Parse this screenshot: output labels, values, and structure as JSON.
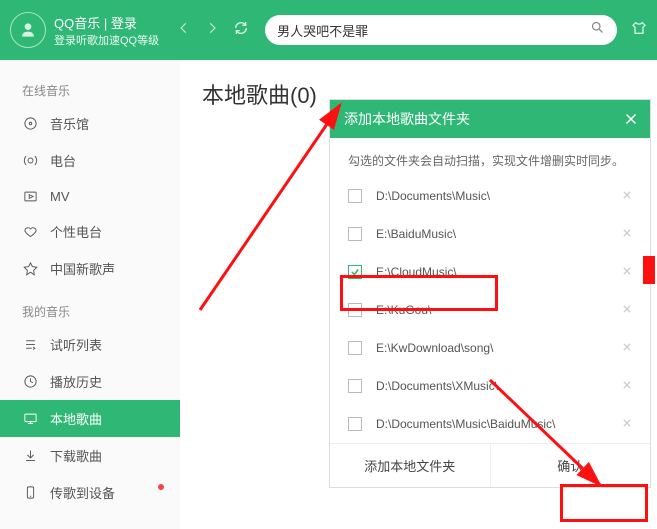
{
  "header": {
    "app_title": "QQ音乐 | 登录",
    "login_sub": "登录听歌加速QQ等级",
    "search_value": "男人哭吧不是罪"
  },
  "sidebar": {
    "section_online": "在线音乐",
    "online_items": [
      {
        "label": "音乐馆",
        "icon": "disc"
      },
      {
        "label": "电台",
        "icon": "radio"
      },
      {
        "label": "MV",
        "icon": "play"
      },
      {
        "label": "个性电台",
        "icon": "heart"
      },
      {
        "label": "中国新歌声",
        "icon": "star"
      }
    ],
    "section_mine": "我的音乐",
    "mine_items": [
      {
        "label": "试听列表",
        "icon": "list"
      },
      {
        "label": "播放历史",
        "icon": "clock"
      },
      {
        "label": "本地歌曲",
        "icon": "computer",
        "active": true
      },
      {
        "label": "下载歌曲",
        "icon": "download"
      },
      {
        "label": "传歌到设备",
        "icon": "phone",
        "badge": true
      }
    ]
  },
  "main": {
    "title": "本地歌曲(0)"
  },
  "dialog": {
    "title": "添加本地歌曲文件夹",
    "tip": "勾选的文件夹会自动扫描，实现文件增删实时同步。",
    "folders": [
      {
        "path": "D:\\Documents\\Music\\",
        "checked": false
      },
      {
        "path": "E:\\BaiduMusic\\",
        "checked": false
      },
      {
        "path": "E:\\CloudMusic\\",
        "checked": true
      },
      {
        "path": "E:\\KuGou\\",
        "checked": false
      },
      {
        "path": "E:\\KwDownload\\song\\",
        "checked": false
      },
      {
        "path": "D:\\Documents\\XMusic\\",
        "checked": false
      },
      {
        "path": "D:\\Documents\\Music\\BaiduMusic\\",
        "checked": false
      }
    ],
    "add_btn": "添加本地文件夹",
    "ok_btn": "确认"
  }
}
